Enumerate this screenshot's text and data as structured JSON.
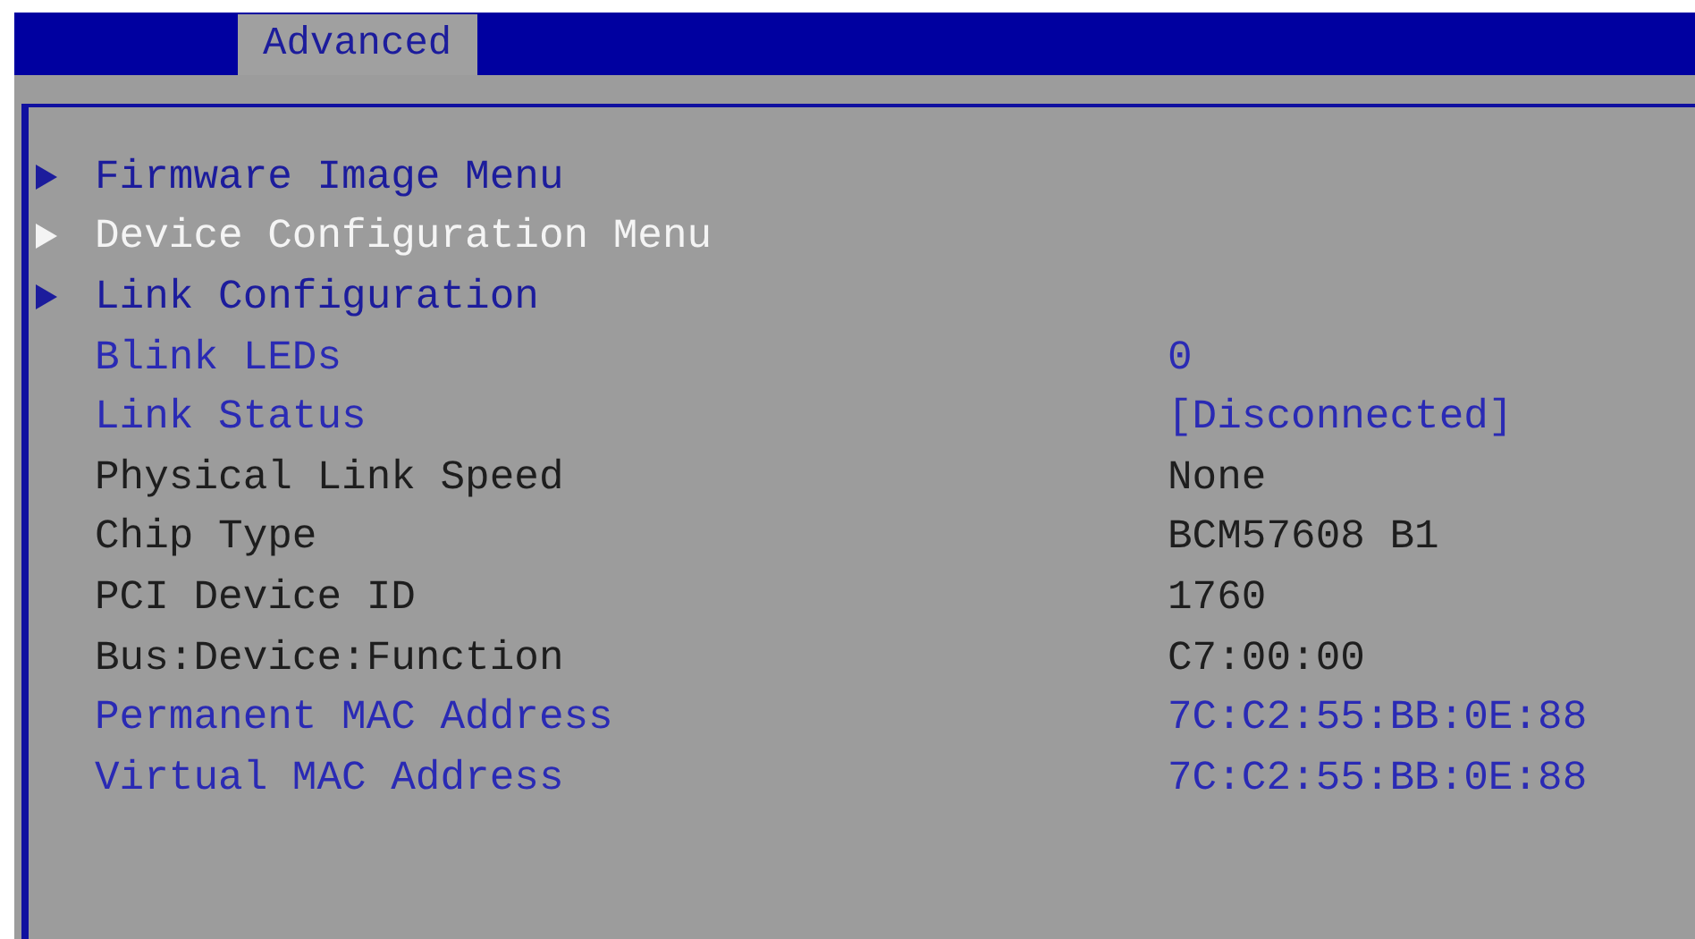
{
  "tabs": [
    {
      "label": "Advanced",
      "selected": true
    }
  ],
  "items": [
    {
      "kind": "submenu",
      "label": "Firmware Image Menu",
      "selected": false
    },
    {
      "kind": "submenu",
      "label": "Device Configuration Menu",
      "selected": true
    },
    {
      "kind": "submenu",
      "label": "Link Configuration",
      "selected": false
    },
    {
      "kind": "setting",
      "label": "Blink LEDs",
      "value": "0",
      "selected": false
    },
    {
      "kind": "setting",
      "label": "Link Status",
      "value": "[Disconnected]",
      "selected": false
    },
    {
      "kind": "info",
      "label": "Physical Link Speed",
      "value": "None",
      "selected": false
    },
    {
      "kind": "info",
      "label": "Chip Type",
      "value": "BCM57608 B1",
      "selected": false
    },
    {
      "kind": "info",
      "label": "PCI Device ID",
      "value": "1760",
      "selected": false
    },
    {
      "kind": "info",
      "label": "Bus:Device:Function",
      "value": "C7:00:00",
      "selected": false
    },
    {
      "kind": "setting",
      "label": "Permanent MAC Address",
      "value": "7C:C2:55:BB:0E:88",
      "selected": false
    },
    {
      "kind": "setting",
      "label": "Virtual MAC Address",
      "value": "7C:C2:55:BB:0E:88",
      "selected": false
    }
  ]
}
